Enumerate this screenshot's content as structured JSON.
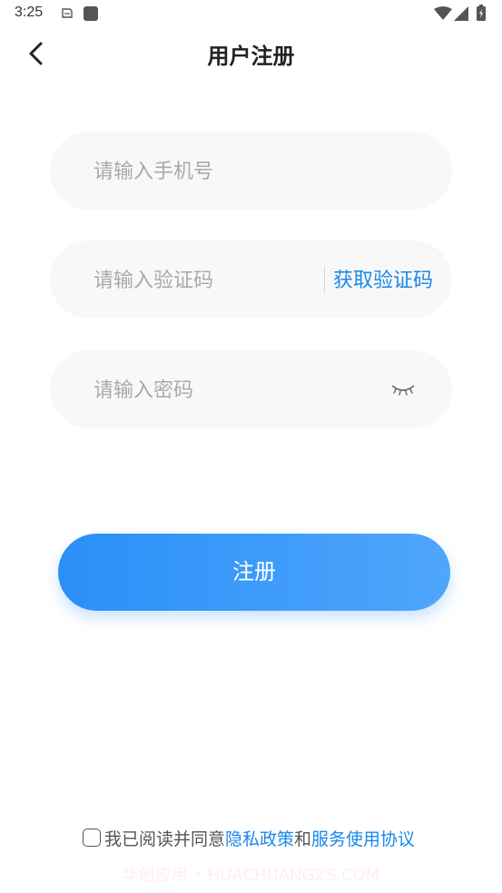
{
  "status_bar": {
    "time": "3:25",
    "icons": [
      "notification-icon",
      "app-icon",
      "wifi-icon",
      "signal-icon",
      "battery-icon"
    ]
  },
  "header": {
    "title": "用户注册"
  },
  "form": {
    "phone_placeholder": "请输入手机号",
    "code_placeholder": "请输入验证码",
    "get_code_label": "获取验证码",
    "password_placeholder": "请输入密码"
  },
  "register_button": "注册",
  "agreement": {
    "prefix": "我已阅读并同意",
    "privacy_link": "隐私政策",
    "and": "和",
    "terms_link": "服务使用协议"
  },
  "watermark": "华创应用 • HUACHUANGZS.COM",
  "colors": {
    "accent": "#1a88e8",
    "button_start": "#2a8ff8",
    "button_end": "#4fa6fb",
    "field_bg": "#f8f8f8"
  }
}
